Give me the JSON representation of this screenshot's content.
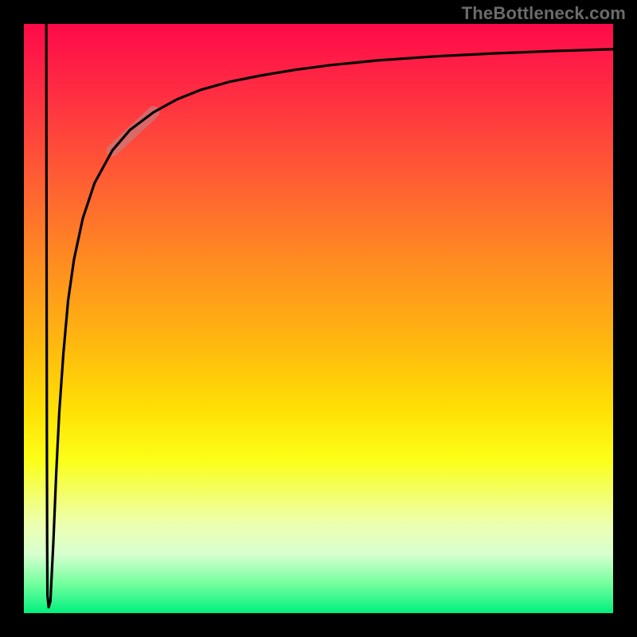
{
  "watermark": "TheBottleneck.com",
  "chart_data": {
    "type": "line",
    "title": "",
    "xlabel": "",
    "ylabel": "",
    "xlim": [
      0,
      100
    ],
    "ylim": [
      0,
      100
    ],
    "grid": false,
    "legend": false,
    "series": [
      {
        "name": "bottleneck-curve",
        "x": [
          3.8,
          3.85,
          3.9,
          3.95,
          4.0,
          4.2,
          4.5,
          5.0,
          5.5,
          6.0,
          6.7,
          7.5,
          8.5,
          10,
          12,
          15,
          18,
          22,
          26,
          30,
          35,
          40,
          46,
          52,
          60,
          70,
          80,
          90,
          100
        ],
        "y": [
          100,
          60,
          30,
          12,
          3,
          1,
          2,
          12,
          24,
          34,
          44,
          53,
          60,
          67,
          73,
          78.5,
          82,
          85,
          87.2,
          88.8,
          90.2,
          91.2,
          92.2,
          93,
          93.8,
          94.5,
          95,
          95.4,
          95.7
        ]
      }
    ],
    "annotations": [
      {
        "name": "highlight-segment",
        "x": [
          15,
          22
        ],
        "y": [
          78.5,
          85
        ],
        "style": "thick-faded-pink"
      }
    ],
    "background_gradient": {
      "direction": "top-to-bottom",
      "stops": [
        {
          "pos": 0.0,
          "color": "#ff0a49"
        },
        {
          "pos": 0.12,
          "color": "#ff2e42"
        },
        {
          "pos": 0.26,
          "color": "#ff5c34"
        },
        {
          "pos": 0.4,
          "color": "#ff8b21"
        },
        {
          "pos": 0.54,
          "color": "#ffb70f"
        },
        {
          "pos": 0.66,
          "color": "#ffe205"
        },
        {
          "pos": 0.74,
          "color": "#fbff17"
        },
        {
          "pos": 0.8,
          "color": "#f3ff6c"
        },
        {
          "pos": 0.85,
          "color": "#edffb1"
        },
        {
          "pos": 0.9,
          "color": "#d7ffcf"
        },
        {
          "pos": 0.95,
          "color": "#74ff9e"
        },
        {
          "pos": 1.0,
          "color": "#00f07e"
        }
      ]
    }
  }
}
